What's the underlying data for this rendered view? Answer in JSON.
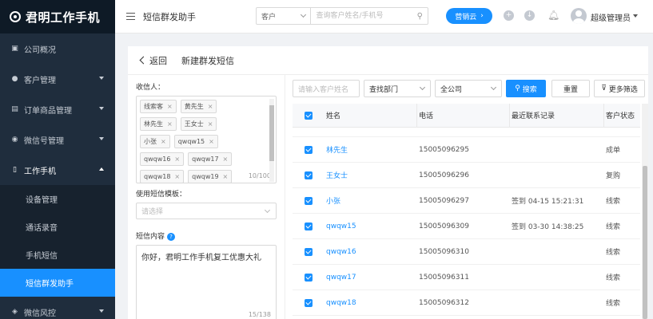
{
  "logo": {
    "text": "君明工作手机"
  },
  "sidebar": {
    "items": [
      {
        "label": "公司概况",
        "icon": "monitor-icon",
        "caret": false
      },
      {
        "label": "客户管理",
        "icon": "users-icon",
        "caret": true
      },
      {
        "label": "订单商品管理",
        "icon": "document-icon",
        "caret": true
      },
      {
        "label": "微信号管理",
        "icon": "wechat-icon",
        "caret": true
      },
      {
        "label": "工作手机",
        "icon": "phone-icon",
        "caret": true,
        "open": true
      }
    ],
    "sub_items": [
      {
        "label": "设备管理"
      },
      {
        "label": "通话录音"
      },
      {
        "label": "手机短信"
      },
      {
        "label": "短信群发助手",
        "active": true
      }
    ],
    "bottom_item": {
      "label": "微信风控",
      "icon": "shield-icon"
    }
  },
  "header": {
    "title": "短信群发助手",
    "search_select": "客户",
    "search_placeholder": "查询客户姓名/手机号",
    "promo_label": "营销云",
    "user_name": "超级管理员"
  },
  "panel": {
    "back_label": "返回",
    "title": "新建群发短信"
  },
  "form": {
    "recipients_label": "收信人：",
    "recipient_tags": [
      [
        "线索客",
        "黄先生"
      ],
      [
        "林先生",
        "王女士"
      ],
      [
        "小张",
        "qwqw15"
      ],
      [
        "qwqw16",
        "qwqw17"
      ],
      [
        "qwqw18",
        "qwqw19"
      ]
    ],
    "recipient_count": "10/100",
    "template_label": "使用短信模板：",
    "template_placeholder": "请选择",
    "sms_label": "短信内容",
    "sms_text": "你好，君明工作手机复工优惠大礼",
    "sms_count": "15/138"
  },
  "filters": {
    "name_placeholder": "请输入客户姓名",
    "dept_value": "查找部门",
    "company_value": "全公司",
    "search_label": "搜索",
    "reset_label": "重置",
    "more_label": "更多筛选"
  },
  "table": {
    "headers": {
      "name": "姓名",
      "phone": "电话",
      "contact": "最近联系记录",
      "status": "客户状态"
    },
    "rows": [
      {
        "name": "林先生",
        "phone": "15005096295",
        "contact": "",
        "status": "成单"
      },
      {
        "name": "王女士",
        "phone": "15005096296",
        "contact": "",
        "status": "复购"
      },
      {
        "name": "小张",
        "phone": "15005096297",
        "contact": "签到 04-15 15:21:31",
        "status": "线索"
      },
      {
        "name": "qwqw15",
        "phone": "15005096309",
        "contact": "签到 03-30 14:38:25",
        "status": "线索"
      },
      {
        "name": "qwqw16",
        "phone": "15005096310",
        "contact": "",
        "status": "线索"
      },
      {
        "name": "qwqw17",
        "phone": "15005096311",
        "contact": "",
        "status": "线索"
      },
      {
        "name": "qwqw18",
        "phone": "15005096312",
        "contact": "",
        "status": "线索"
      }
    ]
  },
  "colors": {
    "primary": "#1890ff",
    "sidebar": "#1f2d3d",
    "sidebar_active": "#1890ff"
  }
}
